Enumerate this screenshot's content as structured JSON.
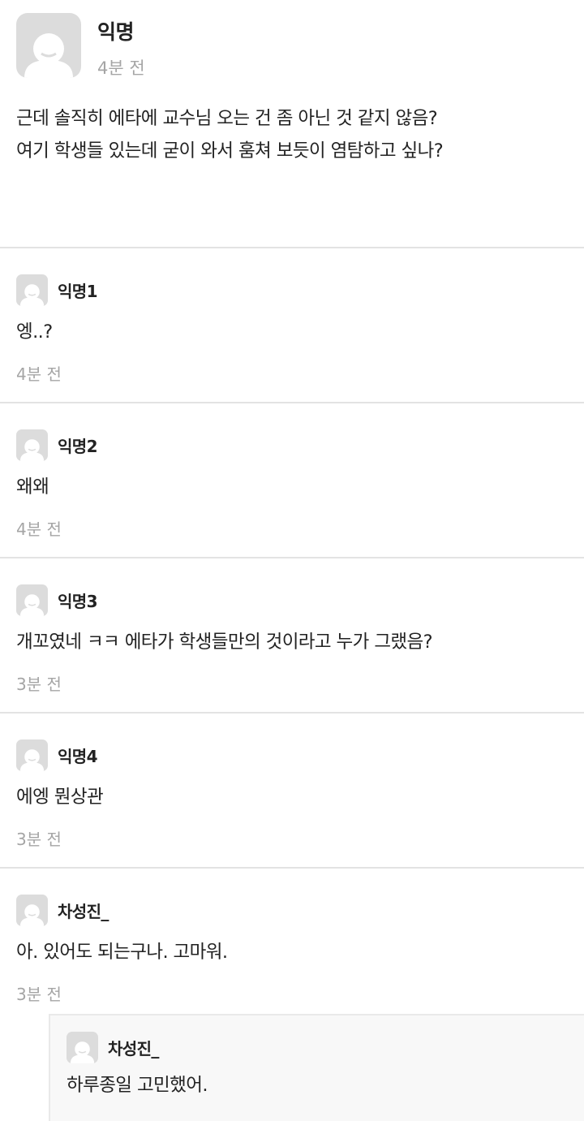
{
  "post": {
    "author": "익명",
    "time": "4분 전",
    "avatar_icon": "default-profile-icon",
    "lines": [
      "근데 솔직히 에타에 교수님 오는 건 좀 아닌 것 같지 않음?",
      "여기 학생들 있는데 굳이 와서 훔쳐 보듯이 염탐하고 싶나?"
    ]
  },
  "comments": [
    {
      "author": "익명1",
      "text": "엥..?",
      "time": "4분 전"
    },
    {
      "author": "익명2",
      "text": "왜왜",
      "time": "4분 전"
    },
    {
      "author": "익명3",
      "text": "개꼬였네 ㅋㅋ 에타가 학생들만의 것이라고 누가 그랬음?",
      "time": "3분 전"
    },
    {
      "author": "익명4",
      "text": "에엥 뭔상관",
      "time": "3분 전"
    },
    {
      "author": "차성진_",
      "text": "아. 있어도 되는구나. 고마워.",
      "time": "3분 전"
    }
  ],
  "reply": {
    "author": "차성진_",
    "text": "하루종일 고민했어."
  },
  "colors": {
    "background": "#ffffff",
    "text": "#222222",
    "muted": "#a5a5a5",
    "divider": "#e3e3e3",
    "avatar_bg": "#dcdcdc",
    "reply_bg": "#f8f8f8"
  }
}
